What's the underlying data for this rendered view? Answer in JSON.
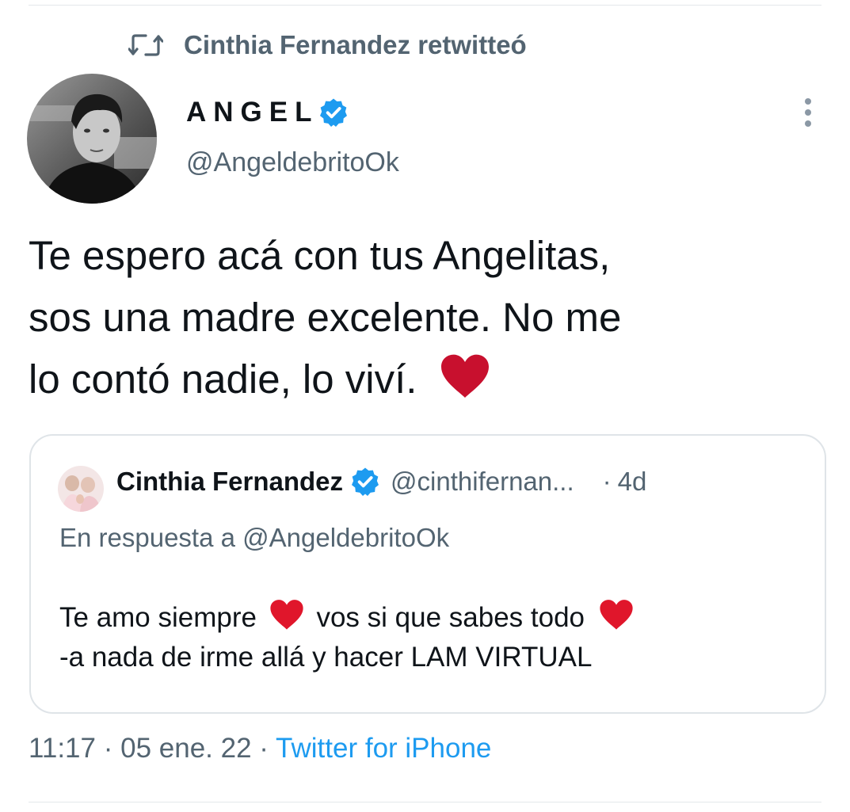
{
  "retweet": {
    "icon": "retweet-icon",
    "text": "Cinthia Fernandez retwitteó"
  },
  "author": {
    "name": "ANGEL",
    "handle": "@AngeldebritoOk",
    "verified_icon": "verified-badge-icon",
    "avatar_icon": "avatar-photo"
  },
  "menu": {
    "icon": "more-vertical-icon"
  },
  "tweet": {
    "text_line1": "Te espero acá con tus Angelitas,",
    "text_line2": "sos una madre excelente. No me",
    "text_line3": "lo contó nadie, lo viví.",
    "heart_icon": "red-heart-emoji"
  },
  "quote": {
    "name": "Cinthia Fernandez",
    "handle": "@cinthifernan...",
    "separator": "·",
    "time": "4d",
    "reply_to": "En respuesta a @AngeldebritoOk",
    "line1_a": "Te amo siempre",
    "line1_b": "vos si que sabes todo",
    "line2": "-a nada de irme allá y hacer LAM VIRTUAL"
  },
  "meta": {
    "time": "11:17",
    "sep1": "·",
    "date": "05 ene. 22",
    "sep2": "·",
    "source": "Twitter for iPhone"
  },
  "colors": {
    "text": "#0f1419",
    "secondary": "#536471",
    "accent": "#1d9bf0",
    "heart": "#d0021b",
    "border": "#dfe4e8"
  }
}
